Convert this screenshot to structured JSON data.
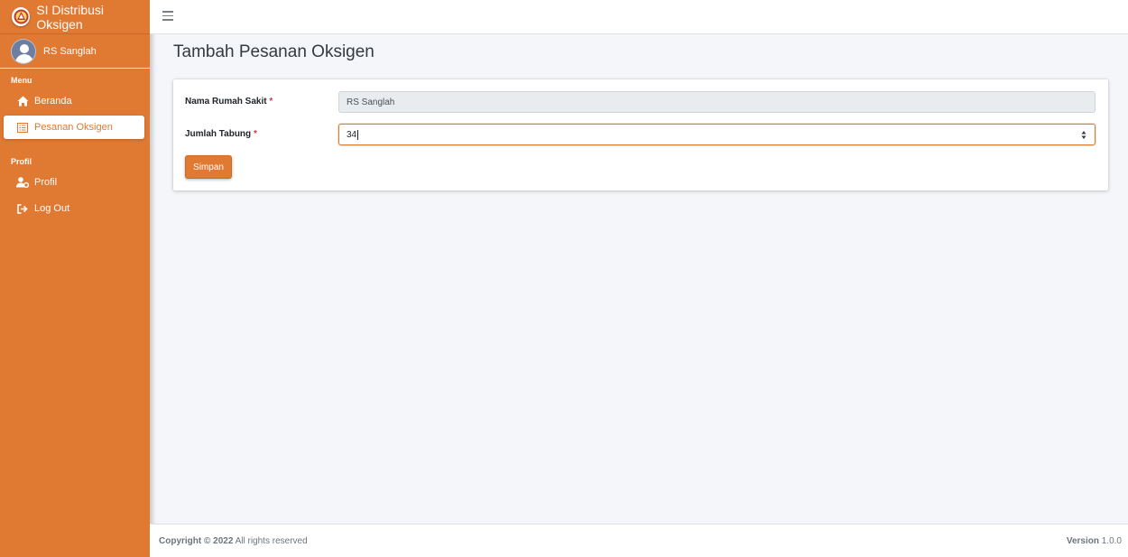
{
  "brand": {
    "title": "SI Distribusi Oksigen",
    "logo_icon": "emblem-logo-icon"
  },
  "user": {
    "name": "RS Sanglah",
    "avatar_icon": "user-avatar-icon"
  },
  "sidebar": {
    "menu_header": "Menu",
    "profile_header": "Profil",
    "items": [
      {
        "label": "Beranda",
        "icon": "home-icon",
        "active": false
      },
      {
        "label": "Pesanan Oksigen",
        "icon": "list-icon",
        "active": true
      },
      {
        "label": "Profil",
        "icon": "user-cog-icon",
        "active": false
      },
      {
        "label": "Log Out",
        "icon": "sign-out-icon",
        "active": false
      }
    ]
  },
  "topbar": {
    "menu_icon": "hamburger-icon"
  },
  "page": {
    "title": "Tambah Pesanan Oksigen"
  },
  "form": {
    "hospital_label": "Nama Rumah Sakit",
    "hospital_value": "RS Sanglah",
    "quantity_label": "Jumlah Tabung",
    "quantity_value": "34",
    "required_mark": "*",
    "submit_label": "Simpan"
  },
  "footer": {
    "copyright_bold": "Copyright © 2022",
    "copyright_rest": " All rights reserved",
    "version_label": "Version",
    "version_value": " 1.0.0"
  },
  "colors": {
    "accent": "#e07a33",
    "background": "#f4f6f9",
    "required": "#dc3545"
  }
}
